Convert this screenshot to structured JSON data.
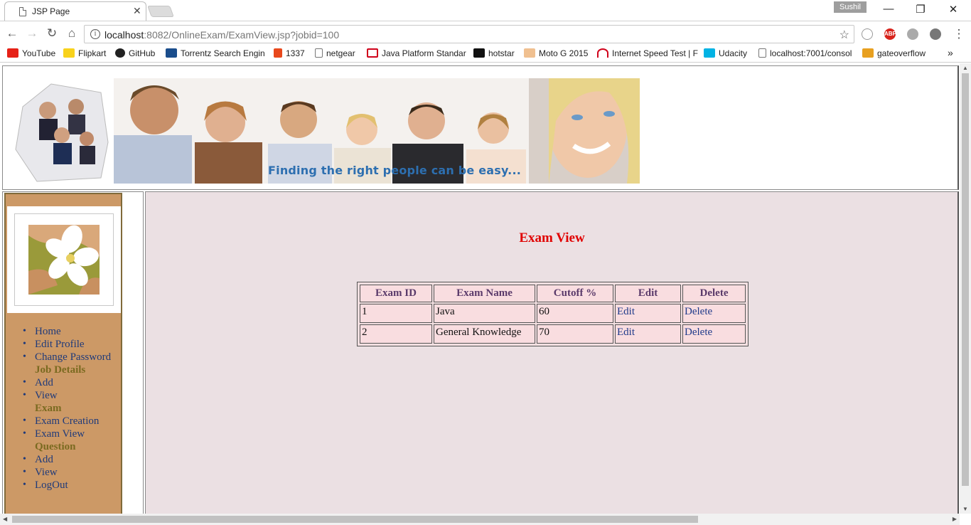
{
  "browser": {
    "tab_title": "JSP Page",
    "tab_close": "✕",
    "profile_name": "Sushil",
    "url_host": "localhost",
    "url_path": ":8082/OnlineExam/ExamView.jsp?jobid=100",
    "bookmarks_more": "»",
    "bookmarks": [
      {
        "label": "YouTube",
        "color": "#e62117"
      },
      {
        "label": "Flipkart",
        "color": "#f8d21c"
      },
      {
        "label": "GitHub",
        "color": "#222222"
      },
      {
        "label": "Torrentz Search Engin",
        "color": "#1a4d8c"
      },
      {
        "label": "1337",
        "color": "#e8481c"
      },
      {
        "label": "netgear",
        "color": "#ffffff"
      },
      {
        "label": "Java Platform Standar",
        "color": "#d0021b"
      },
      {
        "label": "hotstar",
        "color": "#111111"
      },
      {
        "label": "Moto G 2015",
        "color": "#f0c090"
      },
      {
        "label": "Internet Speed Test | F",
        "color": "#d0021b"
      },
      {
        "label": "Udacity",
        "color": "#02b3e4"
      },
      {
        "label": "localhost:7001/consol",
        "color": "#ffffff"
      },
      {
        "label": "gateoverflow",
        "color": "#e8a020"
      }
    ]
  },
  "header": {
    "banner_caption": "Finding the right people can be easy..."
  },
  "sidebar": {
    "items": [
      {
        "label": "Home",
        "type": "link"
      },
      {
        "label": "Edit Profile",
        "type": "link"
      },
      {
        "label": "Change Password",
        "type": "link"
      },
      {
        "label": "Job Details",
        "type": "heading"
      },
      {
        "label": "Add",
        "type": "link"
      },
      {
        "label": "View",
        "type": "link"
      },
      {
        "label": "Exam",
        "type": "heading"
      },
      {
        "label": "Exam Creation",
        "type": "link"
      },
      {
        "label": "Exam View",
        "type": "link"
      },
      {
        "label": "Question",
        "type": "heading"
      },
      {
        "label": "Add",
        "type": "link"
      },
      {
        "label": "View",
        "type": "link"
      },
      {
        "label": "LogOut",
        "type": "link"
      }
    ]
  },
  "main": {
    "title": "Exam View",
    "table": {
      "headers": [
        "Exam ID",
        "Exam Name",
        "Cutoff %",
        "Edit",
        "Delete"
      ],
      "rows": [
        {
          "id": "1",
          "name": "Java",
          "cutoff": "60",
          "edit": "Edit",
          "delete": "Delete"
        },
        {
          "id": "2",
          "name": "General Knowledge",
          "cutoff": "70",
          "edit": "Edit",
          "delete": "Delete"
        }
      ]
    }
  }
}
